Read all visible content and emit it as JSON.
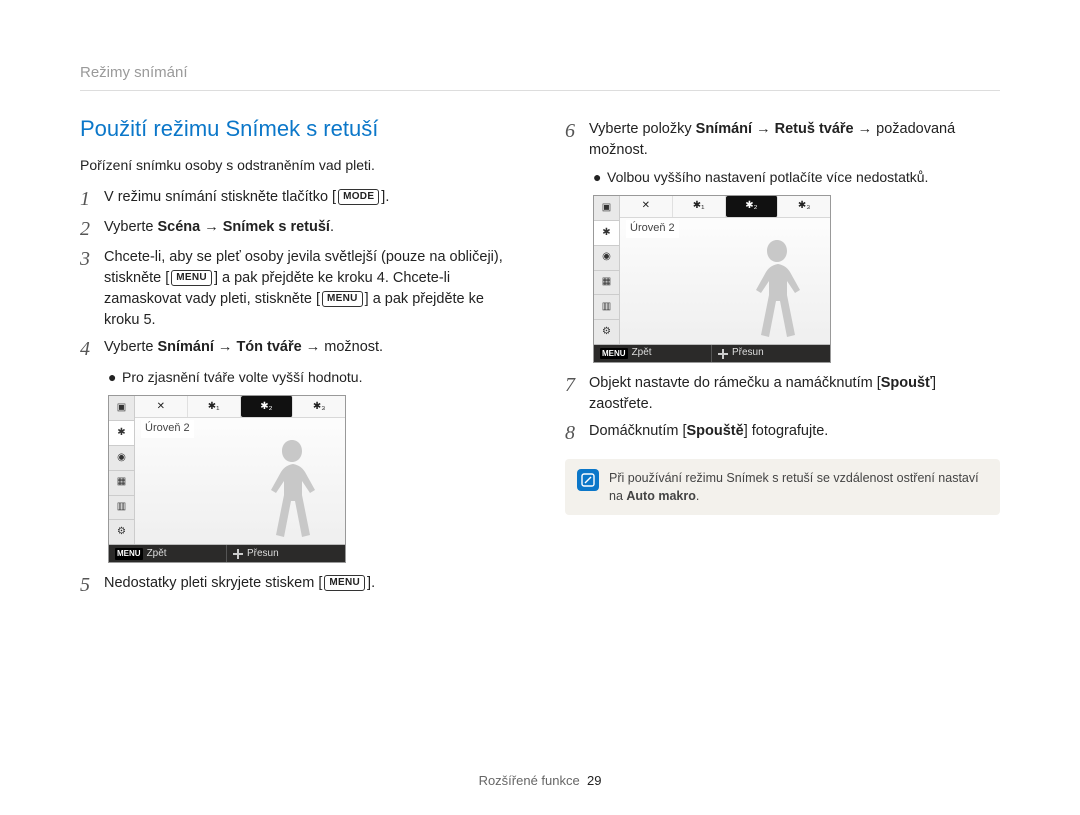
{
  "header": {
    "section": "Režimy snímání"
  },
  "title": "Použití režimu Snímek s retuší",
  "intro": "Pořízení snímku osoby s odstraněním vad pleti.",
  "buttons": {
    "mode": "MODE",
    "menu": "MENU"
  },
  "steps_left": {
    "s1_pre": "V režimu snímání stiskněte tlačítko [",
    "s1_post": "].",
    "s2_pre": "Vyberte ",
    "s2_boldA": "Scéna",
    "s2_arrow": " → ",
    "s2_boldB": "Snímek s retuší",
    "s2_post": ".",
    "s3a": "Chcete-li, aby se pleť osoby jevila světlejší (pouze na obličeji), stiskněte [",
    "s3b": "] a pak přejděte ke kroku 4. Chcete-li zamaskovat vady pleti, stiskněte [",
    "s3c": "] a pak přejděte ke kroku 5.",
    "s4_pre": "Vyberte ",
    "s4_b1": "Snímání",
    "s4_b2": "Tón tváře",
    "s4_post": " → možnost.",
    "s4_bullet": "Pro zjasnění tváře volte vyšší hodnotu.",
    "s5_pre": "Nedostatky pleti skryjete stiskem [",
    "s5_post": "]."
  },
  "steps_right": {
    "s6_pre": "Vyberte položky ",
    "s6_b1": "Snímání",
    "s6_b2": "Retuš tváře",
    "s6_post": " → požadovaná možnost.",
    "s6_bullet": "Volbou vyššího nastavení potlačíte více nedostatků.",
    "s7_a": "Objekt nastavte do rámečku a namáčknutím [",
    "s7_b": "Spoušť",
    "s7_c": "] zaostřete.",
    "s8_a": "Domáčknutím [",
    "s8_b": "Spouště",
    "s8_c": "] fotografujte."
  },
  "ui": {
    "level_label": "Úroveň 2",
    "back": "Zpět",
    "move": "Přesun",
    "options": [
      "✕",
      "✱₁",
      "✱₂",
      "✱₃"
    ]
  },
  "note": {
    "text_a": "Při používání režimu Snímek s retuší se vzdálenost ostření nastaví na ",
    "text_b": "Auto makro",
    "text_c": "."
  },
  "footer": {
    "label": "Rozšířené funkce",
    "page": "29"
  }
}
